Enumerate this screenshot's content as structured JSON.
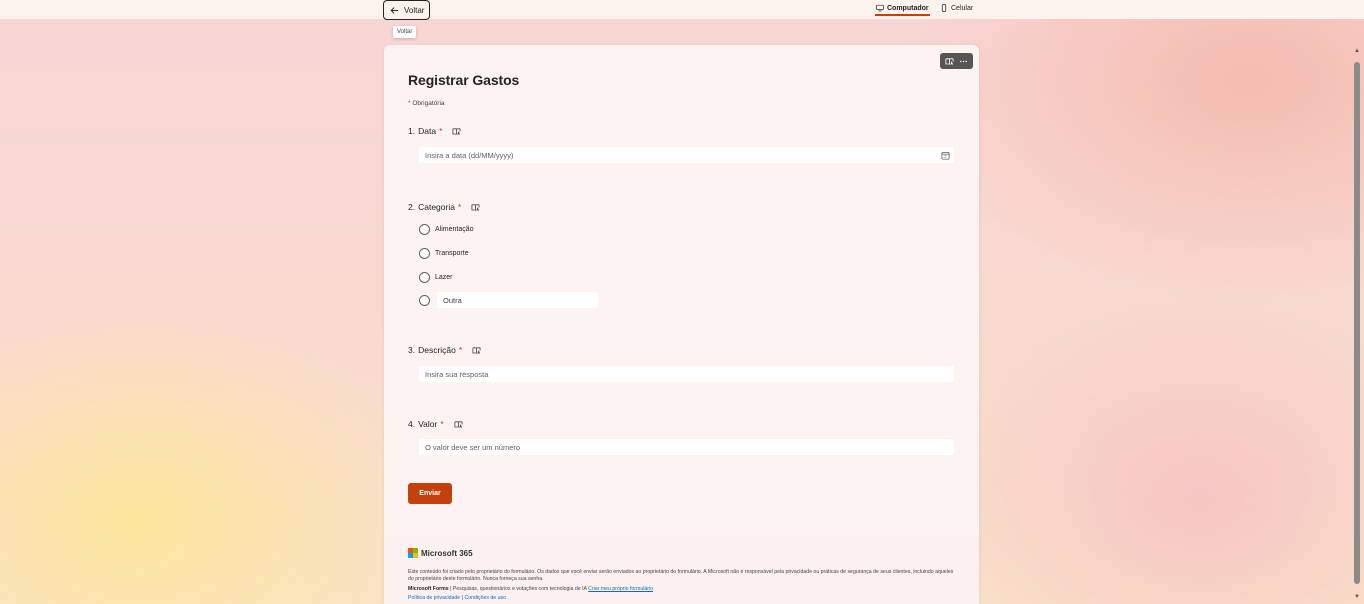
{
  "topbar": {
    "back_label": "Voltar",
    "back_tooltip": "Voltar",
    "view_desktop_label": "Computador",
    "view_mobile_label": "Celular"
  },
  "form": {
    "title": "Registrar Gastos",
    "required_note": "Obrigatória",
    "required_marker": "*",
    "questions": [
      {
        "number": "1.",
        "label": "Data",
        "placeholder": "Insira a data (dd/MM/yyyy)"
      },
      {
        "number": "2.",
        "label": "Categoria",
        "options": [
          "Alimentação",
          "Transporte",
          "Lazer"
        ],
        "other_label": "Outra"
      },
      {
        "number": "3.",
        "label": "Descrição",
        "placeholder": "Insira sua resposta"
      },
      {
        "number": "4.",
        "label": "Valor",
        "placeholder": "O valor deve ser um número"
      }
    ],
    "submit_label": "Enviar"
  },
  "footer": {
    "brand": "Microsoft 365",
    "disclaimer": "Este conteúdo foi criado pelo proprietário do formulário. Os dados que você enviar serão enviados ao proprietário do formulário. A Microsoft não é responsável pela privacidade ou práticas de segurança de seus clientes, incluindo aqueles do proprietário deste formulário. Nunca forneça sua senha.",
    "forms_name": "Microsoft Forms",
    "forms_tagline": "| Pesquisas, questionários e votações com tecnologia de IA",
    "create_link": "Criar meu próprio formulário",
    "privacy_link": "Política de privacidade",
    "separator": "|",
    "terms_link": "Condições de uso"
  },
  "colors": {
    "accent": "#c4410e",
    "required_star": "#c4314b",
    "link": "#0f6cbd"
  }
}
